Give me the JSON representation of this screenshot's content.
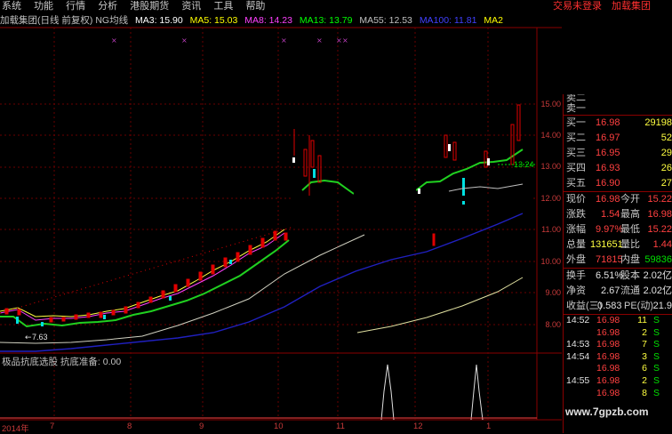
{
  "menu": {
    "items": [
      "系统",
      "功能",
      "行情",
      "分析",
      "港股期货",
      "资讯",
      "工具",
      "帮助"
    ],
    "right_links": [
      "交易未登录",
      "加载集团"
    ]
  },
  "ma_bar": {
    "title": "加载集团(日线 前复权) NG均线",
    "ma3": "MA3: 15.90",
    "ma5": "MA5: 15.03",
    "ma8": "MA8: 14.23",
    "ma13": "MA13: 13.79",
    "ma55": "MA55: 12.53",
    "ma100": "MA100: 11.81",
    "ma2": "MA2",
    "colors": {
      "title": "#c0c0c0",
      "ma3": "#ffffff",
      "ma5": "#ffff00",
      "ma8": "#ff40ff",
      "ma13": "#00ff00",
      "ma55": "#c0c0c0",
      "ma100": "#4040ff"
    }
  },
  "price_axis": [
    "15.00",
    "14.00",
    "13.00",
    "12.00",
    "11.00",
    "10.00",
    "9.00",
    "8.00"
  ],
  "low_marker": "7.63",
  "price_tag": "13.24",
  "indicator_label": "极品抗底选股 抗底准备: 0.00",
  "date_axis": [
    "2014年",
    "7",
    "8",
    "9",
    "10",
    "11",
    "12",
    "1"
  ],
  "quote": {
    "sell_partial": [
      "卖二",
      "卖一"
    ],
    "book": [
      {
        "label": "买一",
        "price": "16.98",
        "vol": "29198"
      },
      {
        "label": "买二",
        "price": "16.97",
        "vol": "52"
      },
      {
        "label": "买三",
        "price": "16.95",
        "vol": "29"
      },
      {
        "label": "买四",
        "price": "16.93",
        "vol": "26"
      },
      {
        "label": "买五",
        "price": "16.90",
        "vol": "27"
      }
    ],
    "stats": [
      {
        "l1": "现价",
        "v1": "16.98",
        "c1": "red",
        "l2": "今开",
        "v2": "15.22",
        "c2": "red"
      },
      {
        "l1": "涨跌",
        "v1": "1.54",
        "c1": "red",
        "l2": "最高",
        "v2": "16.98",
        "c2": "red"
      },
      {
        "l1": "涨幅",
        "v1": "9.97%",
        "c1": "red",
        "l2": "最低",
        "v2": "15.22",
        "c2": "red"
      },
      {
        "l1": "总量",
        "v1": "131651",
        "c1": "yellow",
        "l2": "量比",
        "v2": "1.44",
        "c2": "red"
      },
      {
        "l1": "外盘",
        "v1": "71815",
        "c1": "red",
        "l2": "内盘",
        "v2": "59836",
        "c2": "green"
      }
    ],
    "stats2": [
      {
        "l1": "换手",
        "v1": "6.51%",
        "l2": "股本",
        "v2": "2.02亿"
      },
      {
        "l1": "净资",
        "v1": "2.67",
        "l2": "流通",
        "v2": "2.02亿"
      },
      {
        "l1": "收益(三)",
        "v1": "0.583",
        "l2": "PE(动)",
        "v2": "21.9"
      }
    ],
    "ticks": [
      {
        "time": "14:52",
        "price": "16.98",
        "vol": "11",
        "side": "S"
      },
      {
        "time": "",
        "price": "16.98",
        "vol": "2",
        "side": "S"
      },
      {
        "time": "14:53",
        "price": "16.98",
        "vol": "7",
        "side": "S"
      },
      {
        "time": "14:54",
        "price": "16.98",
        "vol": "3",
        "side": "S"
      },
      {
        "time": "",
        "price": "16.98",
        "vol": "6",
        "side": "S"
      },
      {
        "time": "14:55",
        "price": "16.98",
        "vol": "2",
        "side": "S"
      },
      {
        "time": "",
        "price": "16.98",
        "vol": "8",
        "side": "S"
      }
    ]
  },
  "watermark": "www.7gpzb.com"
}
